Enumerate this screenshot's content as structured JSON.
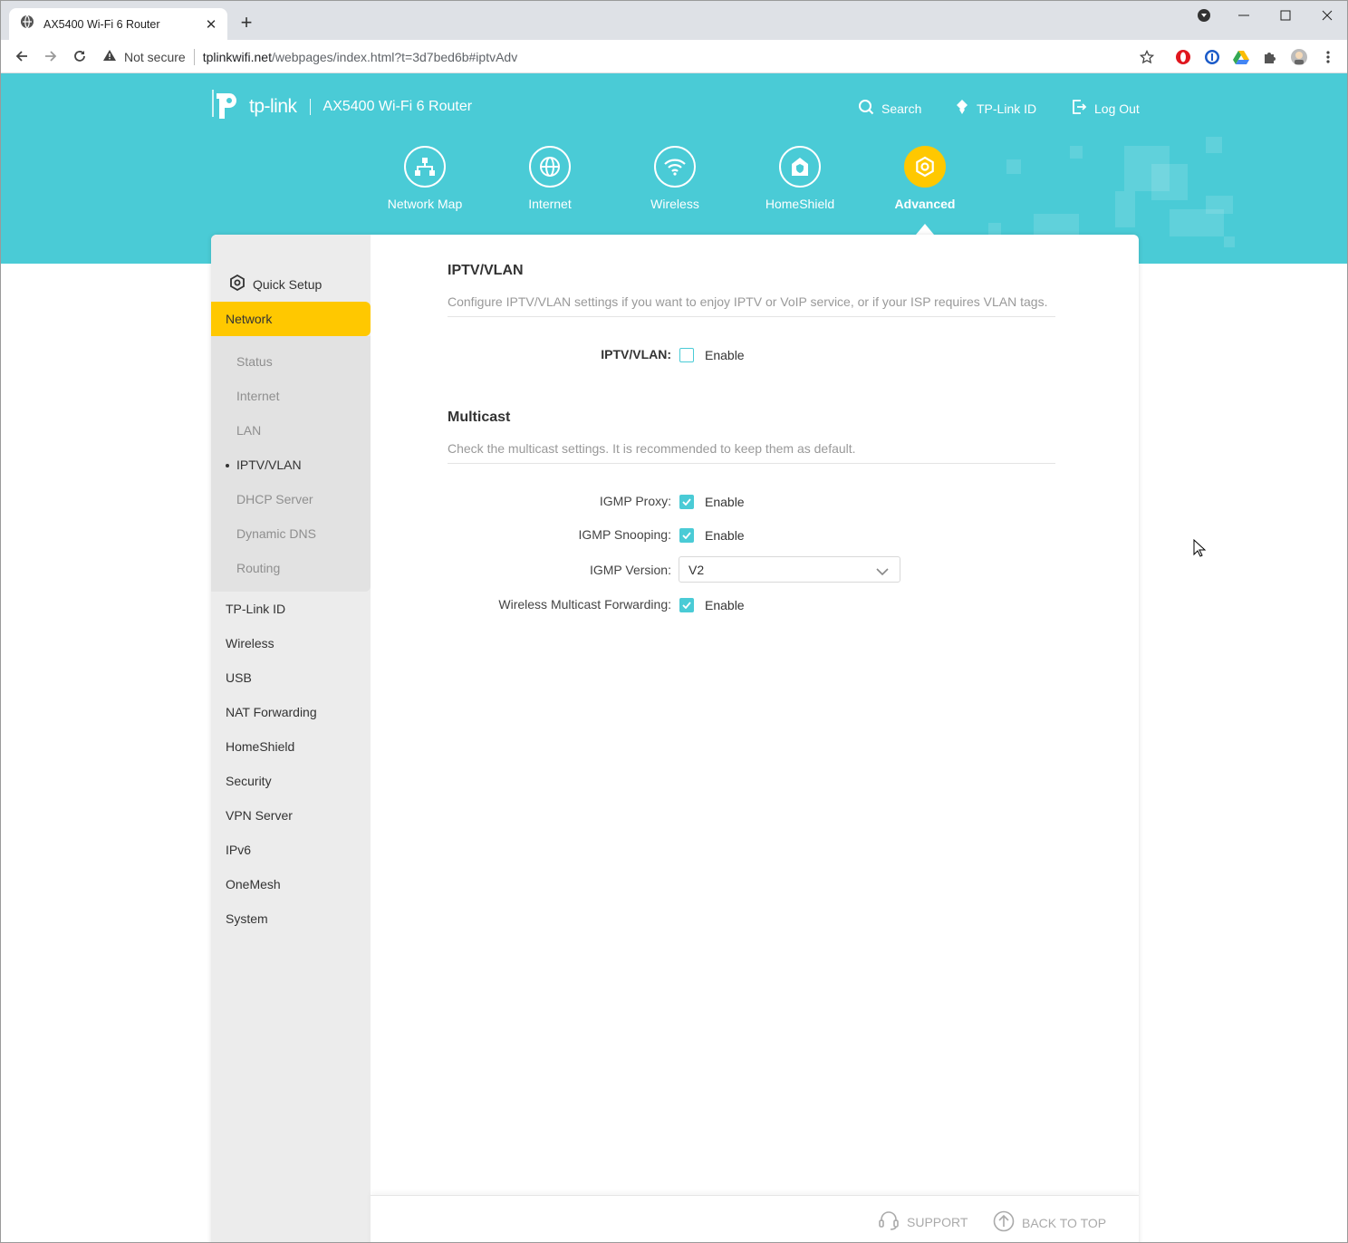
{
  "browser": {
    "tab_title": "AX5400 Wi-Fi 6 Router",
    "not_secure": "Not secure",
    "url_host": "tplinkwifi.net",
    "url_path": "/webpages/index.html?t=3d7bed6b#iptvAdv"
  },
  "header": {
    "brand": "tp-link",
    "model": "AX5400 Wi-Fi 6 Router",
    "links": {
      "search": "Search",
      "tplink_id": "TP-Link ID",
      "logout": "Log Out"
    },
    "nav": [
      {
        "label": "Network Map"
      },
      {
        "label": "Internet"
      },
      {
        "label": "Wireless"
      },
      {
        "label": "HomeShield"
      },
      {
        "label": "Advanced"
      }
    ],
    "accent": "#4acbd6",
    "highlight": "#ffc800"
  },
  "sidebar": {
    "quick_setup": "Quick Setup",
    "network": "Network",
    "network_sub": [
      "Status",
      "Internet",
      "LAN",
      "IPTV/VLAN",
      "DHCP Server",
      "Dynamic DNS",
      "Routing"
    ],
    "items": [
      "TP-Link ID",
      "Wireless",
      "USB",
      "NAT Forwarding",
      "HomeShield",
      "Security",
      "VPN Server",
      "IPv6",
      "OneMesh",
      "System"
    ]
  },
  "iptv": {
    "title": "IPTV/VLAN",
    "desc": "Configure IPTV/VLAN settings if you want to enjoy IPTV or VoIP service, or if your ISP requires VLAN tags.",
    "label": "IPTV/VLAN:",
    "enable": "Enable",
    "checked": false
  },
  "multicast": {
    "title": "Multicast",
    "desc": "Check the multicast settings. It is recommended to keep them as default.",
    "igmp_proxy_label": "IGMP Proxy:",
    "igmp_snooping_label": "IGMP Snooping:",
    "igmp_version_label": "IGMP Version:",
    "igmp_version_value": "V2",
    "wmf_label": "Wireless Multicast Forwarding:",
    "enable": "Enable"
  },
  "footer": {
    "support": "SUPPORT",
    "back_to_top": "BACK TO TOP"
  }
}
